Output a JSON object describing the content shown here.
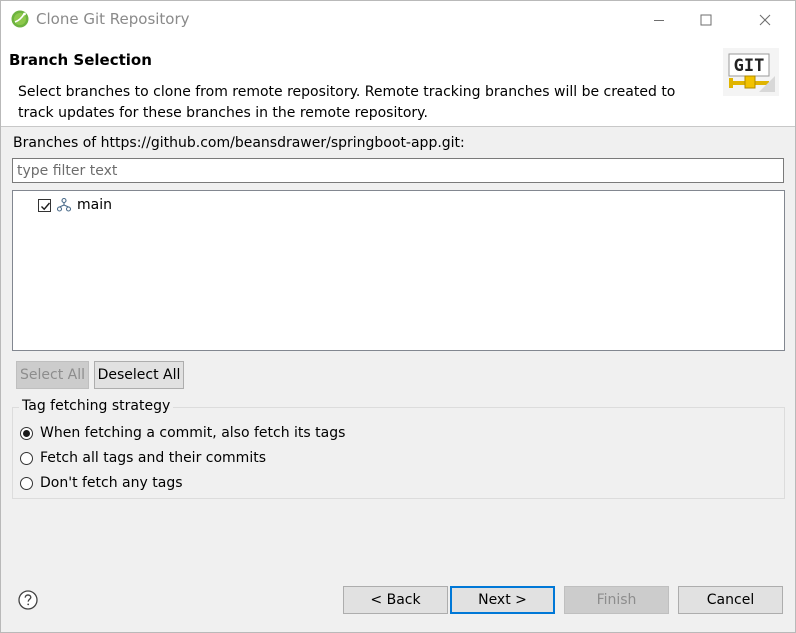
{
  "window": {
    "title": "Clone Git Repository",
    "minimize_symbol": "—",
    "maximize_symbol": "☐",
    "close_symbol": "✕"
  },
  "header": {
    "title": "Branch Selection",
    "description": "Select branches to clone from remote repository. Remote tracking branches will be created to track updates for these branches in the remote repository.",
    "logo_text": "GIT"
  },
  "branches": {
    "label": "Branches of https://github.com/beansdrawer/springboot-app.git:",
    "filter_placeholder": "type filter text",
    "filter_value": "",
    "items": [
      {
        "name": "main",
        "checked": true,
        "icon": "branch-icon"
      }
    ],
    "select_all_label": "Select All",
    "deselect_all_label": "Deselect All"
  },
  "tag_strategy": {
    "title": "Tag fetching strategy",
    "options": [
      {
        "label": "When fetching a commit, also fetch its tags",
        "selected": true
      },
      {
        "label": "Fetch all tags and their commits",
        "selected": false
      },
      {
        "label": "Don't fetch any tags",
        "selected": false
      }
    ]
  },
  "footer": {
    "help_icon": "help-icon",
    "back_label": "< Back",
    "next_label": "Next >",
    "finish_label": "Finish",
    "cancel_label": "Cancel"
  },
  "colors": {
    "dialog_bg": "#f0f0f0",
    "accent": "#0078d7",
    "disabled_text": "#8d8d8d"
  }
}
